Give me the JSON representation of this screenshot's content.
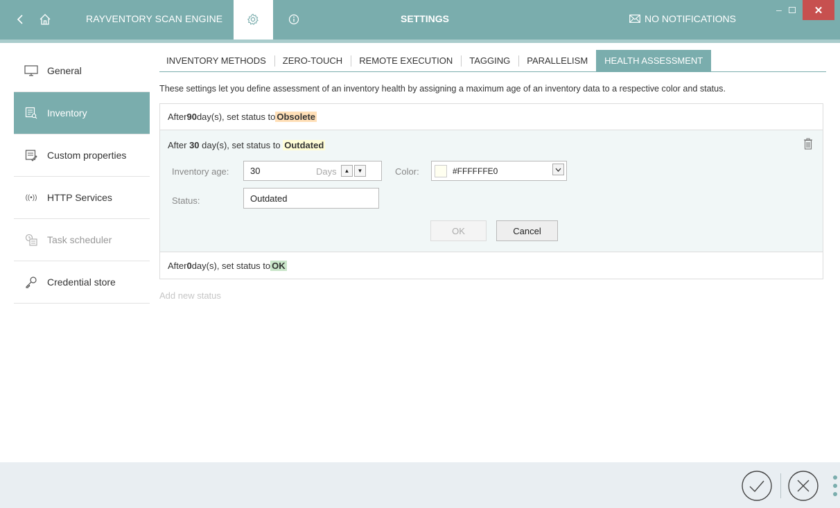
{
  "titlebar": {
    "app_name": "RAYVENTORY SCAN ENGINE",
    "title": "SETTINGS",
    "notifications": "NO NOTIFICATIONS",
    "close_label": "✕"
  },
  "sidebar": {
    "items": [
      {
        "label": "General",
        "icon": "monitor-icon"
      },
      {
        "label": "Inventory",
        "icon": "inventory-icon"
      },
      {
        "label": "Custom properties",
        "icon": "custom-properties-icon"
      },
      {
        "label": "HTTP Services",
        "icon": "broadcast-icon"
      },
      {
        "label": "Task scheduler",
        "icon": "scheduler-icon"
      },
      {
        "label": "Credential store",
        "icon": "key-icon"
      }
    ],
    "active_index": 1
  },
  "tabs": [
    "INVENTORY METHODS",
    "ZERO-TOUCH",
    "REMOTE EXECUTION",
    "TAGGING",
    "PARALLELISM",
    "HEALTH ASSESSMENT"
  ],
  "description": "These settings let you define assessment of an inventory health by assigning a maximum age of an inventory data to a respective color and status.",
  "statuses": [
    {
      "prefix": "After ",
      "days": "90",
      "middle": " day(s), set status to ",
      "status": "Obsolete",
      "color": "#ffdfb7"
    },
    {
      "prefix": "After ",
      "days": "30",
      "middle": " day(s), set status to ",
      "status": "Outdated",
      "color": "#fffdd6"
    },
    {
      "prefix": "After ",
      "days": "0",
      "middle": " day(s), set status to ",
      "status": "OK",
      "color": "#c9e5c9"
    }
  ],
  "editor": {
    "age_label": "Inventory age:",
    "age_value": "30",
    "unit": "Days",
    "color_label": "Color:",
    "color_value": "#FFFFFFE0",
    "status_label": "Status:",
    "status_value": "Outdated",
    "ok_label": "OK",
    "cancel_label": "Cancel"
  },
  "add_new": "Add new status",
  "colors": {
    "accent": "#7aadad",
    "close": "#c7504f"
  }
}
